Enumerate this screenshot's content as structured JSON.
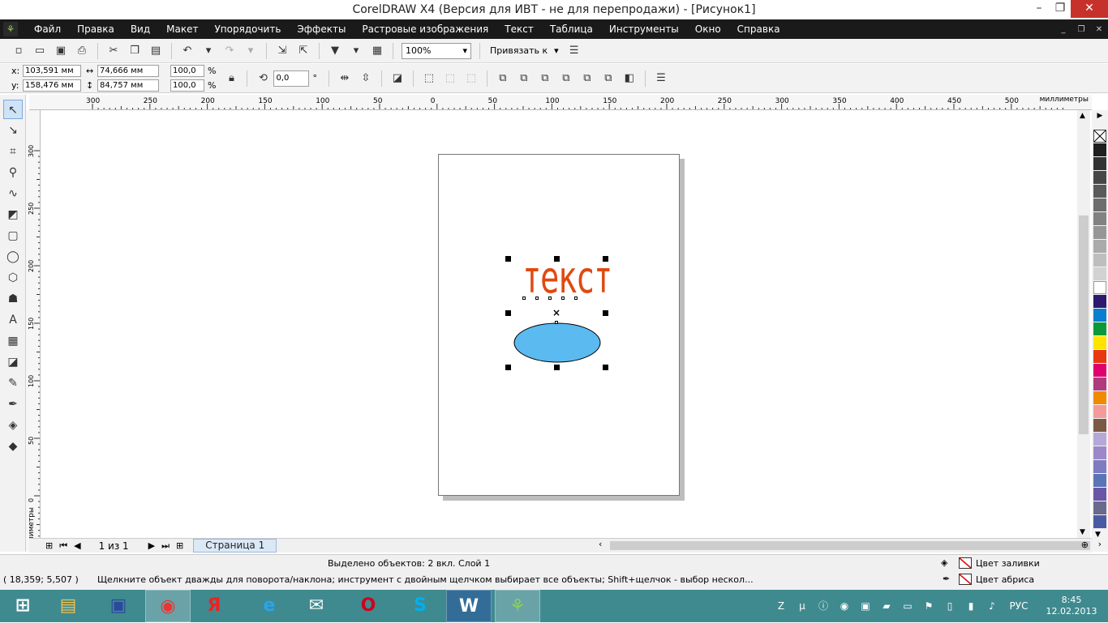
{
  "window": {
    "title": "CorelDRAW X4 (Версия для ИВТ - не для перепродажи) - [Рисунок1]",
    "minimize_glyph": "–",
    "restore_glyph": "❐",
    "close_glyph": "✕"
  },
  "menu": {
    "items": [
      {
        "label": "Файл"
      },
      {
        "label": "Правка"
      },
      {
        "label": "Вид"
      },
      {
        "label": "Макет"
      },
      {
        "label": "Упорядочить"
      },
      {
        "label": "Эффекты"
      },
      {
        "label": "Растровые изображения"
      },
      {
        "label": "Текст"
      },
      {
        "label": "Таблица"
      },
      {
        "label": "Инструменты"
      },
      {
        "label": "Окно"
      },
      {
        "label": "Справка"
      }
    ]
  },
  "toolbar": {
    "zoom_value": "100%",
    "snap_label": "Привязать к"
  },
  "property_bar": {
    "x_label": "x:",
    "y_label": "y:",
    "x_value": "103,591 мм",
    "y_value": "158,476 мм",
    "width_value": "74,666 мм",
    "height_value": "84,757 мм",
    "scale_x": "100,0",
    "scale_y": "100,0",
    "percent": "%",
    "rotation": "0,0",
    "degree": "°"
  },
  "rulers": {
    "unit_label": "миллиметры",
    "top_ticks": [
      "300",
      "250",
      "200",
      "150",
      "100",
      "50",
      "0",
      "50",
      "100",
      "150",
      "200",
      "250",
      "300",
      "350",
      "400",
      "450",
      "500"
    ],
    "left_ticks": [
      "300",
      "250",
      "200",
      "150",
      "100",
      "50",
      "0"
    ]
  },
  "document": {
    "text_object": "текст",
    "text_color": "#e04a10",
    "ellipse_fill": "#5bbaf0"
  },
  "page_nav": {
    "counter": "1 из 1",
    "tab_label": "Страница 1"
  },
  "status": {
    "selection_info": "Выделено объектов: 2 вкл. Слой 1",
    "coords": "( 18,359; 5,507 )",
    "hint": "Щелкните объект дважды для поворота/наклона; инструмент с двойным щелчком выбирает все объекты; Shift+щелчок - выбор нескол...",
    "fill_label": "Цвет заливки",
    "outline_label": "Цвет абриса"
  },
  "palette": [
    "#1f1f1f",
    "#333333",
    "#474747",
    "#5a5a5a",
    "#6e6e6e",
    "#828282",
    "#969696",
    "#aaaaaa",
    "#bebebe",
    "#d2d2d2",
    "#ffffff",
    "#2d1a6e",
    "#0a7fd0",
    "#0a9a3c",
    "#ffe400",
    "#e8380d",
    "#e0006e",
    "#b03a7e",
    "#f08a00",
    "#f39a9a",
    "#7a5a44",
    "#b6a8d6",
    "#9c87c9",
    "#7f7bc0",
    "#5a74b8",
    "#6a56a6",
    "#6a6a8e",
    "#4b5ba3"
  ],
  "tray": {
    "lang": "РУС",
    "time": "8:45",
    "date": "12.02.2013"
  }
}
